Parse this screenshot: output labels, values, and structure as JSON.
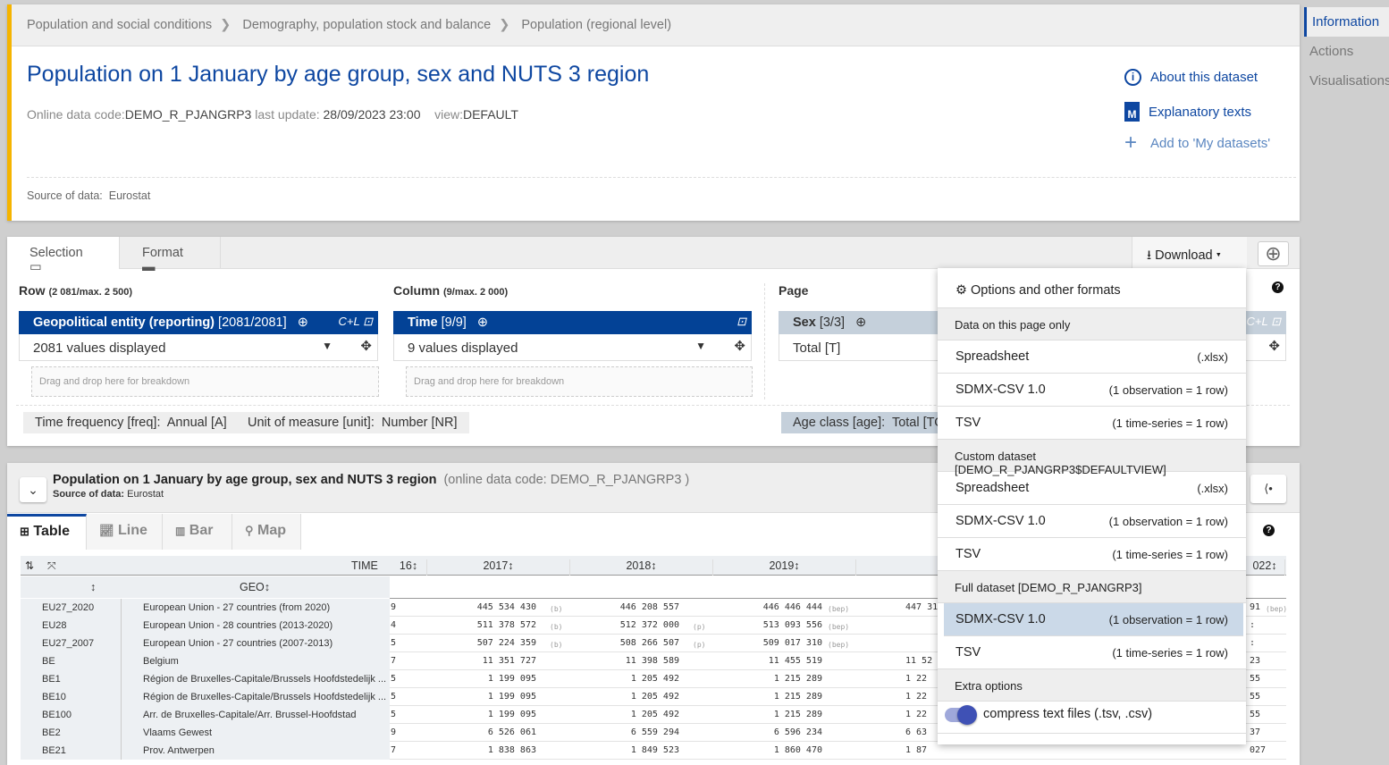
{
  "breadcrumb": [
    "Population and social conditions",
    "Demography, population stock and balance",
    "Population (regional level)"
  ],
  "dataset": {
    "title": "Population on 1 January by age group, sex and NUTS 3 region",
    "code_label": "Online data code:",
    "code": "DEMO_R_PJANGRP3",
    "update_label": "last update:",
    "update": "28/09/2023 23:00",
    "view_label": "view:",
    "view": "DEFAULT",
    "source_label": "Source of data:",
    "source": "Eurostat"
  },
  "links": {
    "about": "About this dataset",
    "explanatory": "Explanatory texts",
    "add": "Add to 'My datasets'"
  },
  "side_nav": [
    {
      "label": "Information",
      "active": true
    },
    {
      "label": "Actions"
    },
    {
      "label": "Visualisations"
    }
  ],
  "selection": {
    "tabs": [
      "Selection",
      "Format"
    ],
    "download": "Download",
    "row": {
      "label": "Row",
      "limit": "(2 081/max. 2 500)",
      "dim": "Geopolitical entity (reporting)",
      "count": "[2081/2081]",
      "cl": "C+L",
      "values": "2081 values displayed",
      "drop": "Drag and drop here for breakdown"
    },
    "column": {
      "label": "Column",
      "limit": "(9/max. 2 000)",
      "dim": "Time",
      "count": "[9/9]",
      "values": "9 values displayed",
      "drop": "Drag and drop here for breakdown"
    },
    "page": {
      "label": "Page",
      "dim": "Sex",
      "count": "[3/3]",
      "cl": "C+L",
      "values": "Total [T]"
    },
    "chips": [
      {
        "k": "Time frequency [freq]:",
        "v": "Annual [A]"
      },
      {
        "k": "Unit of measure [unit]:",
        "v": "Number [NR]"
      },
      {
        "k": "Age class [age]:",
        "v": "Total [TOTAL]"
      }
    ]
  },
  "viz": {
    "title": "Population on 1 January by age group, sex and NUTS 3 region",
    "code": "(online data code: DEMO_R_PJANGRP3 )",
    "source_label": "Source of data:",
    "source": "Eurostat",
    "tabs": [
      "Table",
      "Line",
      "Bar",
      "Map"
    ]
  },
  "table": {
    "time_label": "TIME",
    "geo_label": "GEO",
    "years": [
      "16",
      "2017",
      "2018",
      "2019",
      "",
      "022"
    ],
    "rows": [
      [
        "EU27_2020",
        "European Union - 27 countries (from 2020)",
        "9",
        "445 534 430",
        "(b)",
        "446 208 557",
        "",
        "446 446 444",
        "(bep)",
        "447 31",
        "91",
        "(bep)"
      ],
      [
        "EU28",
        "European Union - 28 countries (2013-2020)",
        "4",
        "511 378 572",
        "(b)",
        "512 372 000",
        "(p)",
        "513 093 556",
        "(bep)",
        "",
        ":",
        ""
      ],
      [
        "EU27_2007",
        "European Union - 27 countries (2007-2013)",
        "5",
        "507 224 359",
        "(b)",
        "508 266 507",
        "(p)",
        "509 017 310",
        "(bep)",
        "",
        ":",
        ""
      ],
      [
        "BE",
        "Belgium",
        "7",
        "11 351 727",
        "",
        "11 398 589",
        "",
        "11 455 519",
        "",
        "11 52",
        "23",
        ""
      ],
      [
        "BE1",
        "Région de Bruxelles-Capitale/Brussels Hoofdstedelijk ...",
        "5",
        "1 199 095",
        "",
        "1 205 492",
        "",
        "1 215 289",
        "",
        "1 22",
        "55",
        ""
      ],
      [
        "BE10",
        "Région de Bruxelles-Capitale/Brussels Hoofdstedelijk ...",
        "5",
        "1 199 095",
        "",
        "1 205 492",
        "",
        "1 215 289",
        "",
        "1 22",
        "55",
        ""
      ],
      [
        "BE100",
        "Arr. de Bruxelles-Capitale/Arr. Brussel-Hoofdstad",
        "5",
        "1 199 095",
        "",
        "1 205 492",
        "",
        "1 215 289",
        "",
        "1 22",
        "55",
        ""
      ],
      [
        "BE2",
        "Vlaams Gewest",
        "9",
        "6 526 061",
        "",
        "6 559 294",
        "",
        "6 596 234",
        "",
        "6 63",
        "37",
        ""
      ],
      [
        "BE21",
        "Prov. Antwerpen",
        "7",
        "1 838 863",
        "",
        "1 849 523",
        "",
        "1 860 470",
        "",
        "1 87",
        "027",
        ""
      ]
    ]
  },
  "download_menu": {
    "header": "Options and other formats",
    "items": [
      {
        "type": "sec",
        "label": "Data on this page only"
      },
      {
        "label": "Spreadsheet",
        "r": "(.xlsx)"
      },
      {
        "label": "SDMX-CSV 1.0",
        "r": "(1 observation = 1 row)"
      },
      {
        "label": "TSV",
        "r": "(1 time-series = 1 row)"
      },
      {
        "type": "sec",
        "label": "Custom dataset [DEMO_R_PJANGRP3$DEFAULTVIEW]"
      },
      {
        "label": "Spreadsheet",
        "r": "(.xlsx)"
      },
      {
        "label": "SDMX-CSV 1.0",
        "r": "(1 observation = 1 row)"
      },
      {
        "label": "TSV",
        "r": "(1 time-series = 1 row)"
      },
      {
        "type": "sec",
        "label": "Full dataset [DEMO_R_PJANGRP3]"
      },
      {
        "label": "SDMX-CSV 1.0",
        "r": "(1 observation = 1 row)",
        "highlight": true
      },
      {
        "label": "TSV",
        "r": "(1 time-series = 1 row)"
      },
      {
        "type": "sec",
        "label": "Extra options"
      }
    ],
    "compress": {
      "label": "compress text files (.tsv, .csv)",
      "on": true
    }
  },
  "colors": {
    "accent": "#0e47a1",
    "bar": "#034296",
    "stripe": "#f5b400",
    "highlight": "#cbd9e8"
  }
}
